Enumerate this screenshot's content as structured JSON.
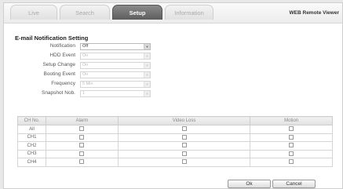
{
  "tabs": [
    {
      "label": "Live"
    },
    {
      "label": "Search"
    },
    {
      "label": "Setup"
    },
    {
      "label": "Information"
    }
  ],
  "header": {
    "app_title": "WEB Remote Viewer"
  },
  "section": {
    "title": "E-mail Notification Setting"
  },
  "form": [
    {
      "label": "Notification",
      "value": "Off"
    },
    {
      "label": "HDD Event",
      "value": "On"
    },
    {
      "label": "Setup Change",
      "value": "On"
    },
    {
      "label": "Booting Event",
      "value": "On"
    },
    {
      "label": "Frequency",
      "value": "5 Min"
    },
    {
      "label": "Snapshot Nob.",
      "value": "1"
    }
  ],
  "table": {
    "columns": [
      "CH No.",
      "Alarm",
      "Video Loss",
      "Motion"
    ],
    "rows": [
      "All",
      "CH1",
      "CH2",
      "CH3",
      "CH4"
    ]
  },
  "buttons": {
    "ok": "Ok",
    "cancel": "Cancel"
  }
}
